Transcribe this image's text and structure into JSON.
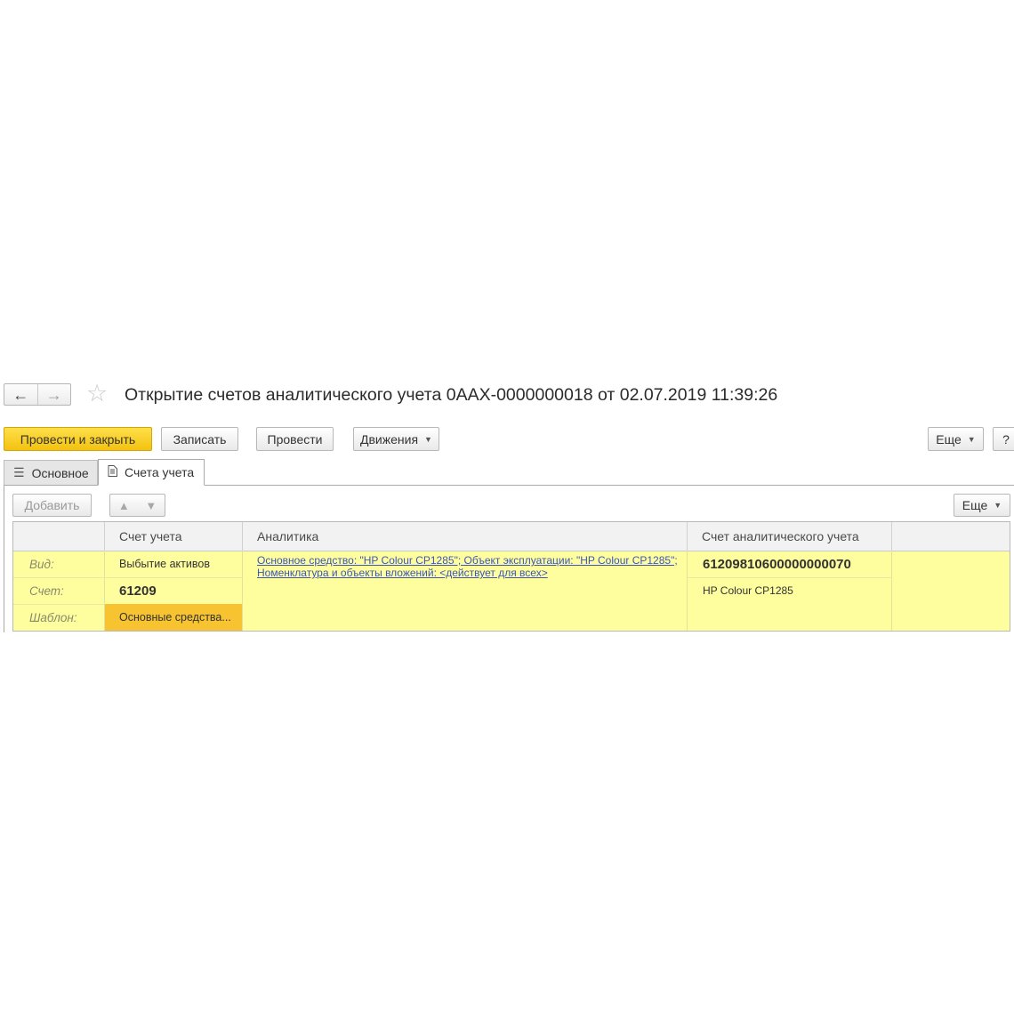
{
  "window": {
    "title": "Открытие счетов аналитического учета 0ААХ-0000000018 от 02.07.2019 11:39:26",
    "nav_back_icon": "←",
    "nav_forward_icon": "→",
    "favorite_icon": "☆"
  },
  "toolbar": {
    "post_close_label": "Провести и закрыть",
    "save_label": "Записать",
    "post_label": "Провести",
    "movements_label": "Движения",
    "more_label": "Еще",
    "help_label": "?",
    "accent_color": "#f5c518"
  },
  "tabs": [
    {
      "label": "Основное",
      "icon": "list-icon"
    },
    {
      "label": "Счета учета",
      "icon": "document-icon",
      "active": true
    }
  ],
  "table_toolbar": {
    "add_label": "Добавить",
    "up_icon": "🡅",
    "down_icon": "🡇",
    "more_label": "Еще"
  },
  "table": {
    "columns": [
      "Счет учета",
      "Аналитика",
      "Счет аналитического учета"
    ],
    "row_color": "#ffff9f",
    "row": {
      "labels": [
        "Вид:",
        "Счет:",
        "Шаблон:"
      ],
      "kind": "Выбытие активов",
      "account": "61209",
      "template": "Основные средства...",
      "analytics_line1": "Основное средство: \"HP Colour CP1285\"; Объект эксплуатации: \"HP Colour CP1285\";",
      "analytics_line2": "Номенклатура и объекты вложений: <действует для всех>",
      "analytic_account": "61209810600000000070",
      "analytic_account_name": "HP Colour CP1285"
    }
  }
}
